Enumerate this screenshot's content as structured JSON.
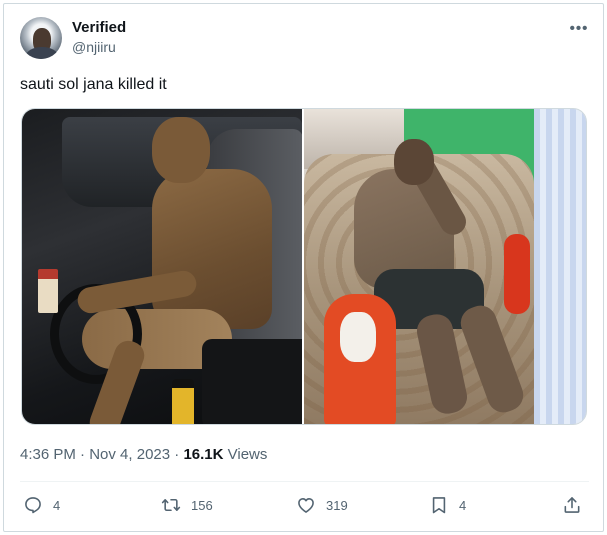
{
  "author": {
    "display_name": "Verified",
    "handle": "@njiiru"
  },
  "tweet": {
    "text": "sauti sol jana killed it",
    "time": "4:36 PM",
    "date": "Nov 4, 2023",
    "separator1": " · ",
    "separator2": " · ",
    "views_count": "16.1K",
    "views_label": " Views"
  },
  "actions": {
    "replies": "4",
    "reposts": "156",
    "likes": "319",
    "bookmarks": "4"
  },
  "icons": {
    "more": "more-horizontal-icon",
    "reply": "reply-icon",
    "repost": "repost-icon",
    "like": "heart-icon",
    "bookmark": "bookmark-icon",
    "share": "share-icon"
  },
  "colors": {
    "text_primary": "#0f1419",
    "text_secondary": "#536471",
    "border": "#cfd9de"
  }
}
